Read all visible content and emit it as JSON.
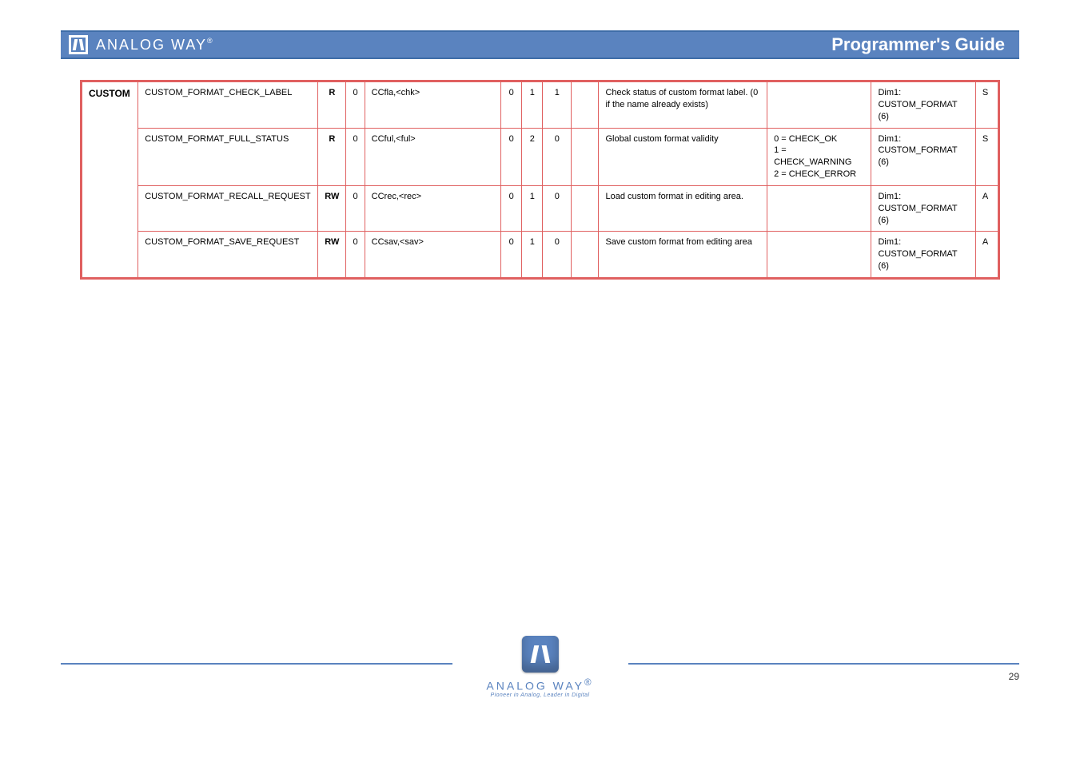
{
  "header": {
    "brand": "ANALOG WAY",
    "reg": "®",
    "title": "Programmer's Guide"
  },
  "group_label": "CUSTOM",
  "rows": [
    {
      "cmd": "CUSTOM_FORMAT_CHECK_LABEL",
      "rw": "R",
      "nreq": "0",
      "ret": "CCfla,<chk>",
      "min": "0",
      "max": "1",
      "def": "1",
      "desc": "Check status of custom format label. (0 if the name already exists)",
      "enum": "",
      "dim": "Dim1: CUSTOM_FORMAT (6)",
      "flag": "S"
    },
    {
      "cmd": "CUSTOM_FORMAT_FULL_STATUS",
      "rw": "R",
      "nreq": "0",
      "ret": "CCful,<ful>",
      "min": "0",
      "max": "2",
      "def": "0",
      "desc": "Global custom format validity",
      "enum": "0 = CHECK_OK\n1 = CHECK_WARNING\n2 = CHECK_ERROR",
      "dim": "Dim1: CUSTOM_FORMAT (6)",
      "flag": "S"
    },
    {
      "cmd": "CUSTOM_FORMAT_RECALL_REQUEST",
      "rw": "RW",
      "nreq": "0",
      "ret": "CCrec,<rec>",
      "min": "0",
      "max": "1",
      "def": "0",
      "desc": "Load custom format in editing area.",
      "enum": "",
      "dim": "Dim1: CUSTOM_FORMAT (6)",
      "flag": "A"
    },
    {
      "cmd": "CUSTOM_FORMAT_SAVE_REQUEST",
      "rw": "RW",
      "nreq": "0",
      "ret": "CCsav,<sav>",
      "min": "0",
      "max": "1",
      "def": "0",
      "desc": "Save custom format from editing area",
      "enum": "",
      "dim": "Dim1: CUSTOM_FORMAT (6)",
      "flag": "A"
    }
  ],
  "footer": {
    "brand": "ANALOG WAY",
    "reg": "®",
    "tagline": "Pioneer in Analog, Leader in Digital",
    "page": "29"
  }
}
